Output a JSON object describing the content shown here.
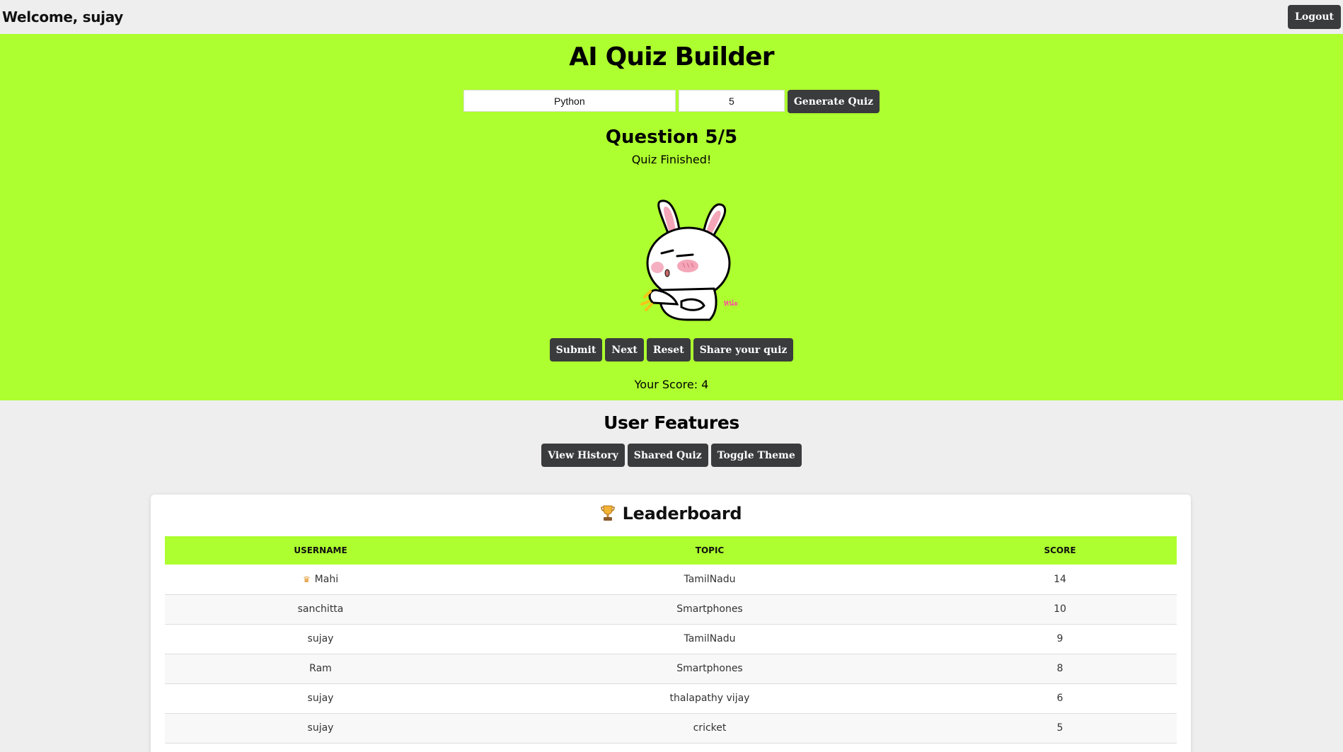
{
  "header": {
    "welcome_text": "Welcome, sujay",
    "logout_label": "Logout"
  },
  "quiz": {
    "title": "AI Quiz Builder",
    "topic_value": "Python",
    "count_value": "5",
    "generate_label": "Generate Quiz",
    "question_heading": "Question 5/5",
    "status_text": "Quiz Finished!",
    "sticker_text": "หน่ะ",
    "buttons": {
      "submit": "Submit",
      "next": "Next",
      "reset": "Reset",
      "share": "Share your quiz"
    },
    "score_text": "Your Score: 4"
  },
  "features": {
    "title": "User Features",
    "buttons": {
      "history": "View History",
      "shared": "Shared Quiz",
      "theme": "Toggle Theme"
    }
  },
  "leaderboard": {
    "title": "Leaderboard",
    "columns": [
      "USERNAME",
      "TOPIC",
      "SCORE"
    ],
    "rows": [
      {
        "username": "Mahi",
        "topic": "TamilNadu",
        "score": "14",
        "crown": "♛"
      },
      {
        "username": "sanchitta",
        "topic": "Smartphones",
        "score": "10"
      },
      {
        "username": "sujay",
        "topic": "TamilNadu",
        "score": "9"
      },
      {
        "username": "Ram",
        "topic": "Smartphones",
        "score": "8"
      },
      {
        "username": "sujay",
        "topic": "thalapathy vijay",
        "score": "6"
      },
      {
        "username": "sujay",
        "topic": "cricket",
        "score": "5"
      }
    ]
  },
  "colors": {
    "accent_green": "#adff2f",
    "button_dark": "#3a3b3d",
    "page_bg": "#eeeeee"
  },
  "icons": {
    "trophy": "trophy-icon",
    "crown": "crown-icon",
    "mascot": "bunny-sticker"
  }
}
